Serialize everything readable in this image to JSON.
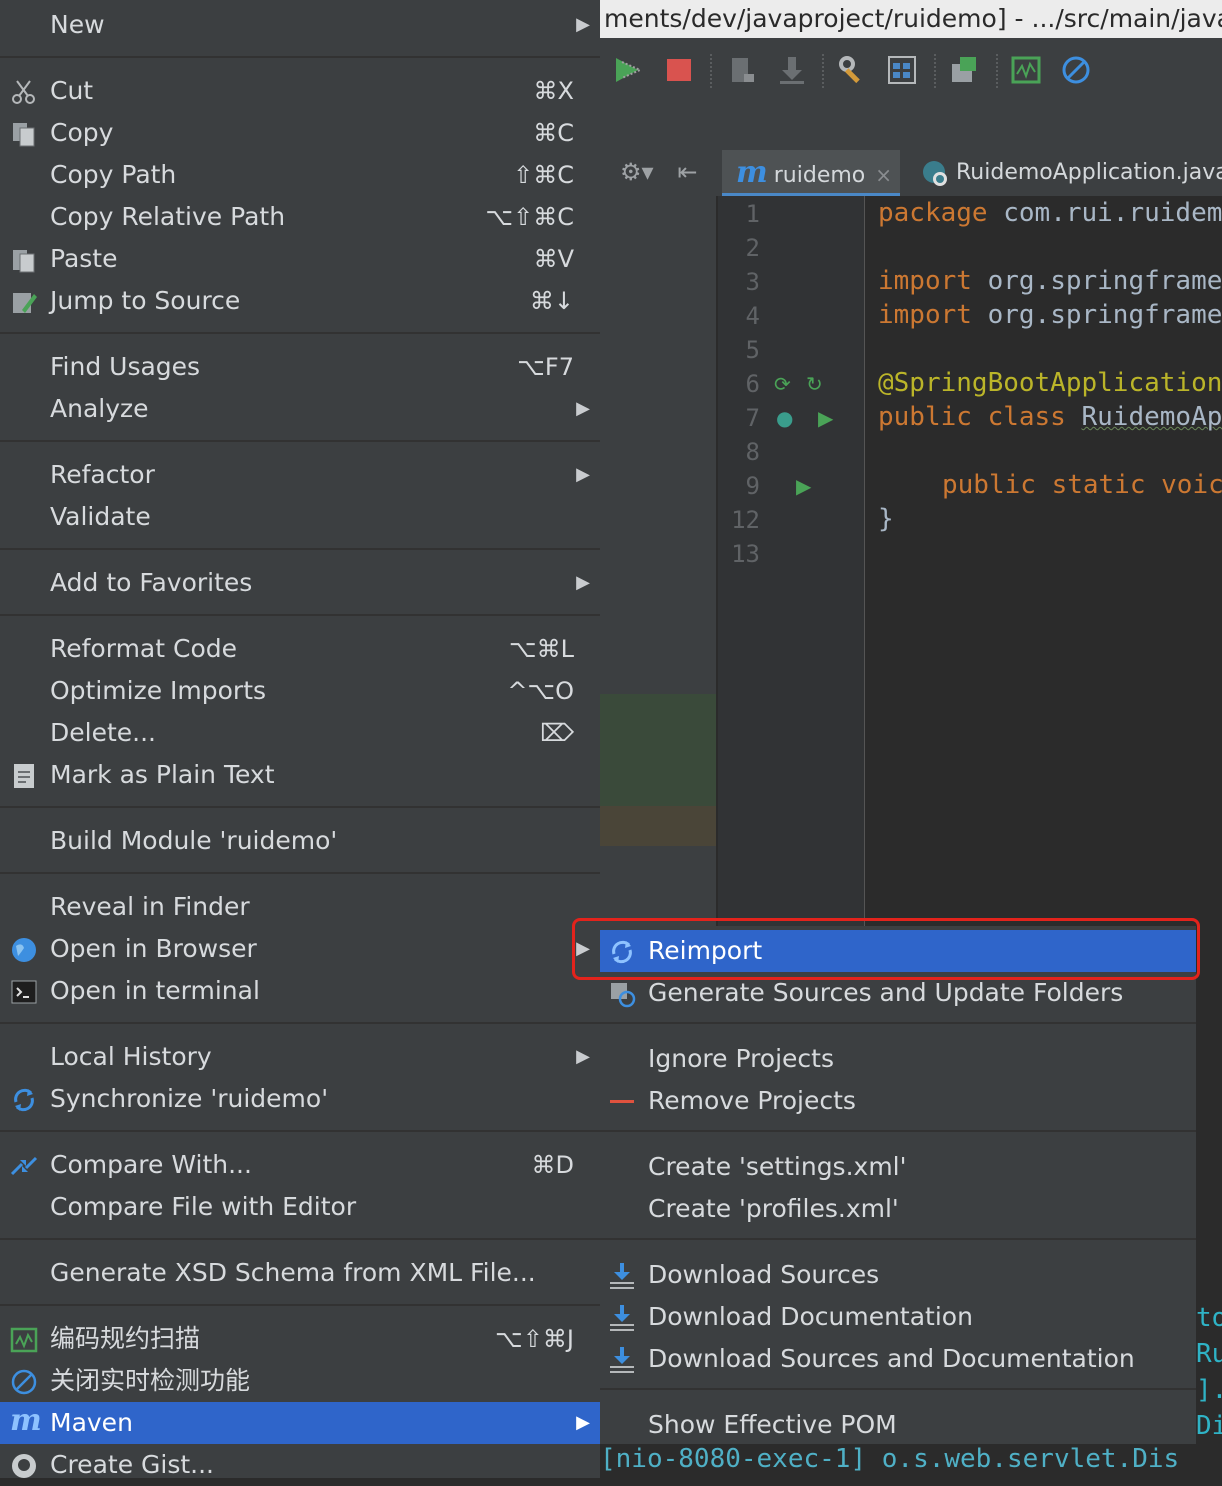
{
  "window": {
    "title_fragment": "ments/dev/javaproject/ruidemo] - .../src/main/java/c"
  },
  "editor": {
    "tabs": [
      {
        "label": "ruidemo",
        "close": "×"
      },
      {
        "label": "RuidemoApplication.java"
      }
    ],
    "line_numbers": [
      "1",
      "2",
      "3",
      "4",
      "5",
      "6",
      "7",
      "8",
      "9",
      "12",
      "13"
    ],
    "code": {
      "l1_kw": "package",
      "l1_rest": " com.rui.ruidem",
      "l3_kw": "import",
      "l3_rest": " org.springframe",
      "l4_kw": "import",
      "l4_rest": " org.springframe",
      "l6": "@SpringBootApplication",
      "l7_kw": "public class",
      "l7_rest": "RuidemoAp",
      "l9_kw": "public static voic",
      "l12": "}"
    },
    "console_right": [
      "to",
      "Rui",
      "].",
      "Dis"
    ],
    "console_bottom": "[nio-8080-exec-1] o.s.web.servlet.Dis"
  },
  "context_menu": {
    "items": {
      "new": {
        "label": "New"
      },
      "cut": {
        "label": "Cut",
        "shortcut": "⌘X"
      },
      "copy": {
        "label": "Copy",
        "shortcut": "⌘C"
      },
      "copy_path": {
        "label": "Copy Path",
        "shortcut": "⇧⌘C"
      },
      "copy_relative_path": {
        "label": "Copy Relative Path",
        "shortcut": "⌥⇧⌘C"
      },
      "paste": {
        "label": "Paste",
        "shortcut": "⌘V"
      },
      "jump_to_source": {
        "label": "Jump to Source",
        "shortcut": "⌘↓"
      },
      "find_usages": {
        "label": "Find Usages",
        "shortcut": "⌥F7"
      },
      "analyze": {
        "label": "Analyze"
      },
      "refactor": {
        "label": "Refactor"
      },
      "validate": {
        "label": "Validate"
      },
      "add_to_favorites": {
        "label": "Add to Favorites"
      },
      "reformat_code": {
        "label": "Reformat Code",
        "shortcut": "⌥⌘L"
      },
      "optimize_imports": {
        "label": "Optimize Imports",
        "shortcut": "^⌥O"
      },
      "delete": {
        "label": "Delete...",
        "shortcut": "⌦"
      },
      "mark_plain_text": {
        "label": "Mark as Plain Text"
      },
      "build_module": {
        "label": "Build Module 'ruidemo'"
      },
      "reveal_in_finder": {
        "label": "Reveal in Finder"
      },
      "open_in_browser": {
        "label": "Open in Browser"
      },
      "open_in_terminal": {
        "label": "Open in terminal"
      },
      "local_history": {
        "label": "Local History"
      },
      "synchronize": {
        "label": "Synchronize 'ruidemo'"
      },
      "compare_with": {
        "label": "Compare With...",
        "shortcut": "⌘D"
      },
      "compare_file_editor": {
        "label": "Compare File with Editor"
      },
      "generate_xsd": {
        "label": "Generate XSD Schema from XML File..."
      },
      "code_scan": {
        "label": "编码规约扫描",
        "shortcut": "⌥⇧⌘J"
      },
      "close_realtime": {
        "label": "关闭实时检测功能"
      },
      "maven": {
        "label": "Maven"
      },
      "create_gist": {
        "label": "Create Gist..."
      }
    }
  },
  "maven_submenu": {
    "reimport": "Reimport",
    "generate_sources": "Generate Sources and Update Folders",
    "ignore_projects": "Ignore Projects",
    "remove_projects": "Remove Projects",
    "create_settings": "Create 'settings.xml'",
    "create_profiles": "Create 'profiles.xml'",
    "download_sources": "Download Sources",
    "download_documentation": "Download Documentation",
    "download_both": "Download Sources and Documentation",
    "show_effective_pom": "Show Effective POM"
  },
  "arrow_glyph": "▶",
  "colors": {
    "menu_bg": "#3c3f41",
    "selection": "#2f65ca",
    "highlight_box": "#e3231c",
    "keyword": "#cc7832",
    "annotation": "#bbb529"
  }
}
